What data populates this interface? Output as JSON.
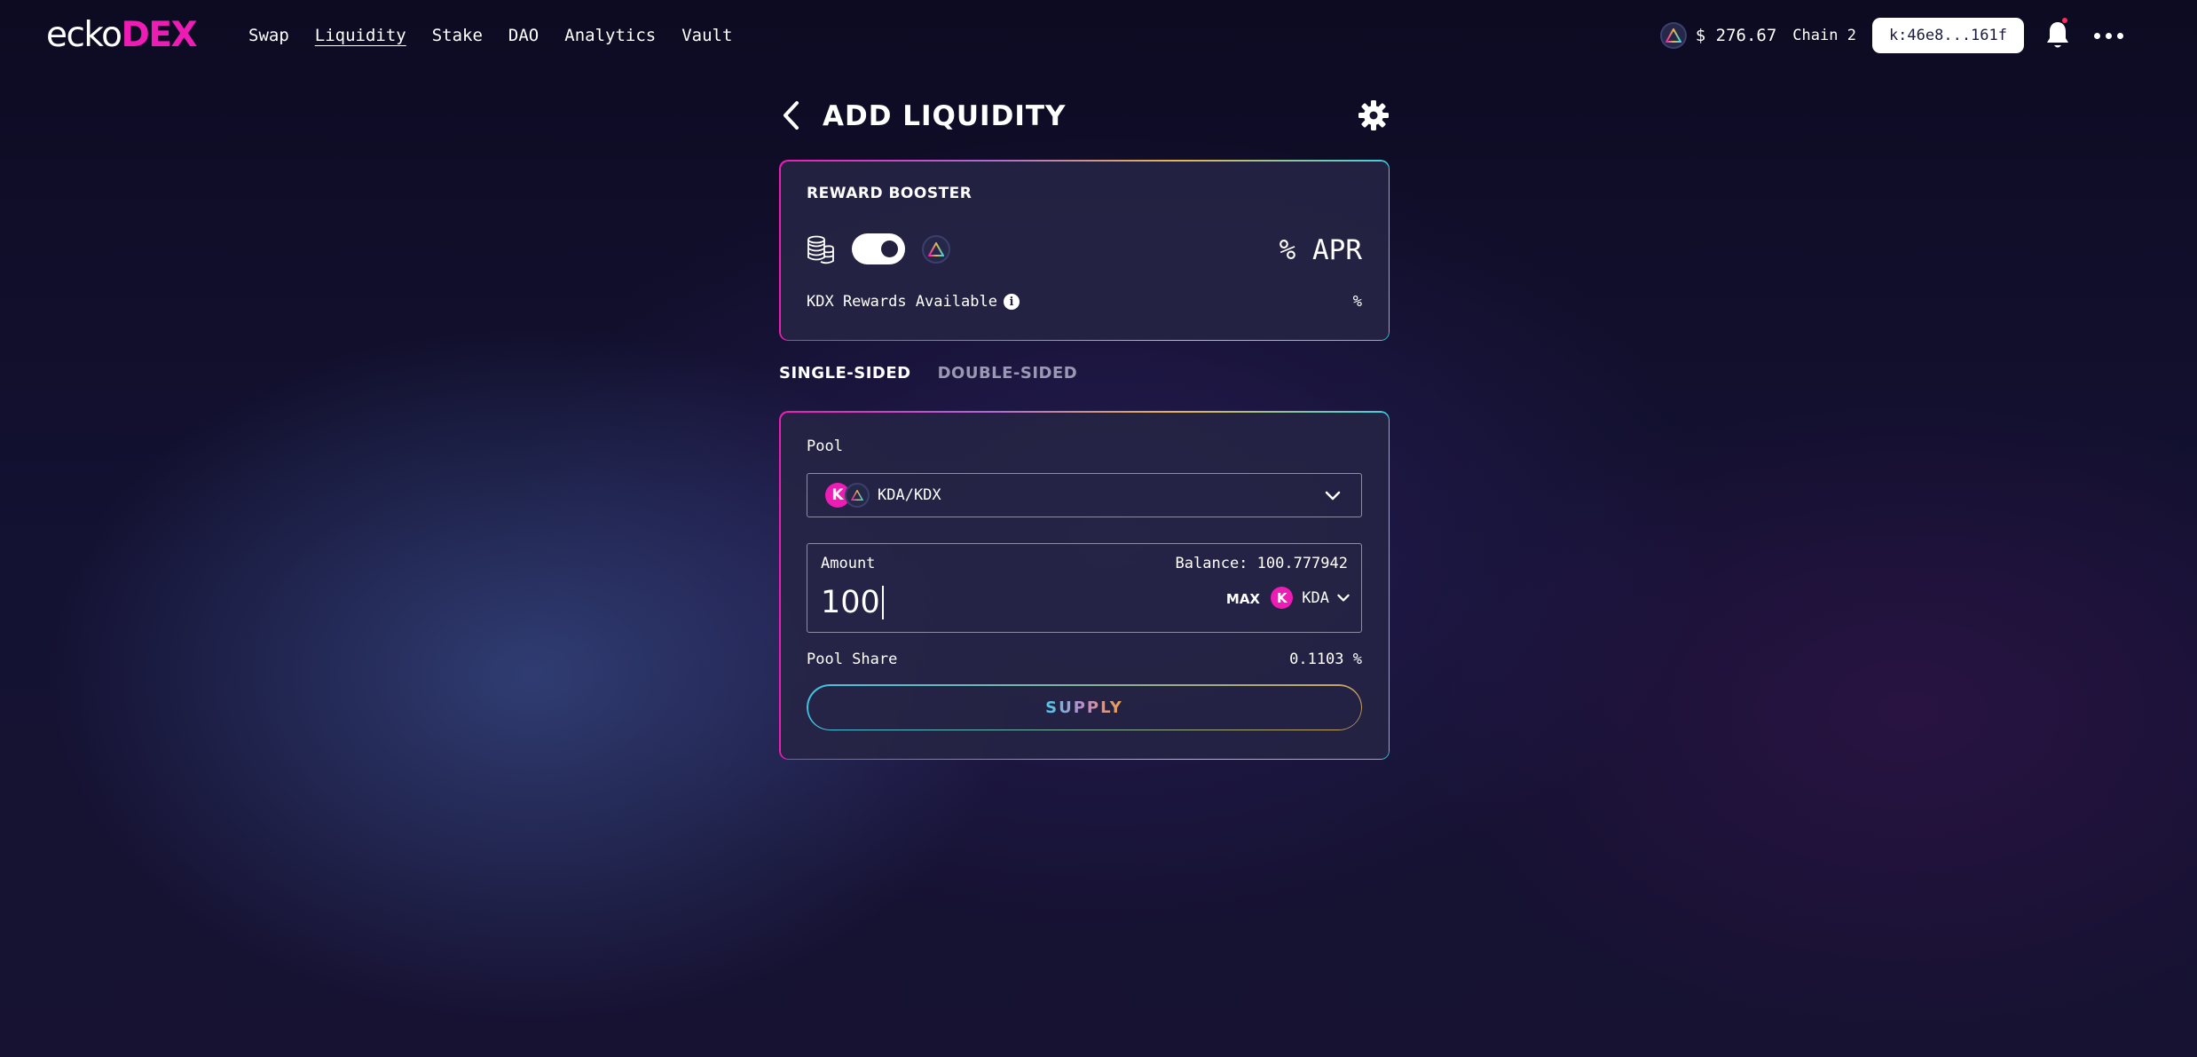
{
  "header": {
    "logo": {
      "part1": "ecko",
      "part2": "DEX"
    },
    "nav": [
      {
        "label": "Swap",
        "active": false
      },
      {
        "label": "Liquidity",
        "active": true
      },
      {
        "label": "Stake",
        "active": false
      },
      {
        "label": "DAO",
        "active": false
      },
      {
        "label": "Analytics",
        "active": false
      },
      {
        "label": "Vault",
        "active": false
      }
    ],
    "kdx_price": "$ 276.67",
    "chain": "Chain 2",
    "account": "k:46e8...161f",
    "has_notification": true
  },
  "page": {
    "title": "ADD LIQUIDITY"
  },
  "booster": {
    "title": "REWARD BOOSTER",
    "toggle_on": true,
    "apr": "% APR",
    "rewards_label": "KDX Rewards Available",
    "rewards_value": "%"
  },
  "tabs": [
    {
      "label": "SINGLE-SIDED",
      "active": true
    },
    {
      "label": "DOUBLE-SIDED",
      "active": false
    }
  ],
  "form": {
    "pool_label": "Pool",
    "pool_value": "KDA/KDX",
    "amount_label": "Amount",
    "balance": "Balance: 100.777942",
    "amount_value": "100",
    "max_label": "MAX",
    "token": "KDA",
    "token_badge": "K",
    "pool_share_label": "Pool Share",
    "pool_share_value": "0.1103 %",
    "supply_label": "SUPPLY"
  },
  "colors": {
    "accent_pink": "#ed1cb5",
    "border_cyan": "#3fd0e0",
    "border_gold": "#e8b64d",
    "background": "#141233"
  },
  "icons": [
    "kdx-token-icon",
    "bell-icon",
    "more-icon",
    "back-arrow-icon",
    "gear-icon",
    "coins-icon",
    "info-icon",
    "chevron-down-icon",
    "kda-token-icon"
  ]
}
